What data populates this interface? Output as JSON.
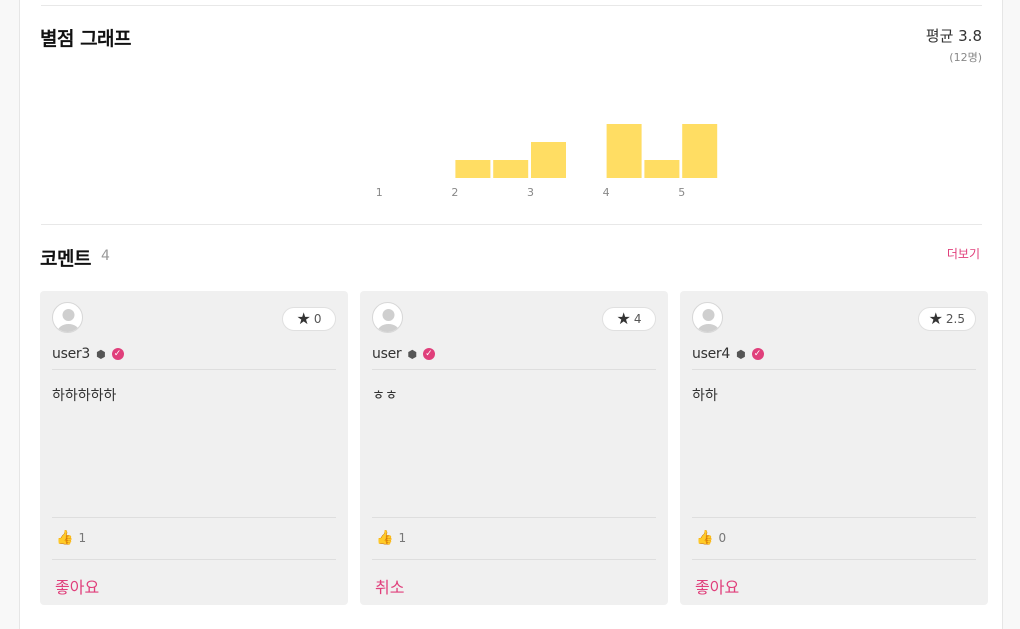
{
  "rating_section": {
    "title": "별점 그래프",
    "average_label": "평균 3.8",
    "count_label": "(12명)"
  },
  "chart_data": {
    "type": "bar",
    "x": [
      0.5,
      1,
      1.5,
      2,
      2.5,
      3,
      3.5,
      4,
      4.5,
      5
    ],
    "values": [
      0,
      0,
      0,
      1,
      1,
      2,
      0,
      3,
      1,
      3
    ],
    "tick_labels": [
      "1",
      "2",
      "3",
      "4",
      "5"
    ],
    "color": "#ffdd63",
    "title": "",
    "xlabel": "",
    "ylabel": ""
  },
  "comments_section": {
    "title": "코멘트",
    "count": "4",
    "more_label": "더보기"
  },
  "comments": [
    {
      "star": "0",
      "username": "user3",
      "text": "하하하하하",
      "likes": "1",
      "action": "좋아요"
    },
    {
      "star": "4",
      "username": "user",
      "text": "ㅎㅎ",
      "likes": "1",
      "action": "취소"
    },
    {
      "star": "2.5",
      "username": "user4",
      "text": "하하",
      "likes": "0",
      "action": "좋아요"
    }
  ],
  "colors": {
    "accent": "#e03f7b",
    "bar": "#ffdd63",
    "card_bg": "#f0f0f0"
  }
}
